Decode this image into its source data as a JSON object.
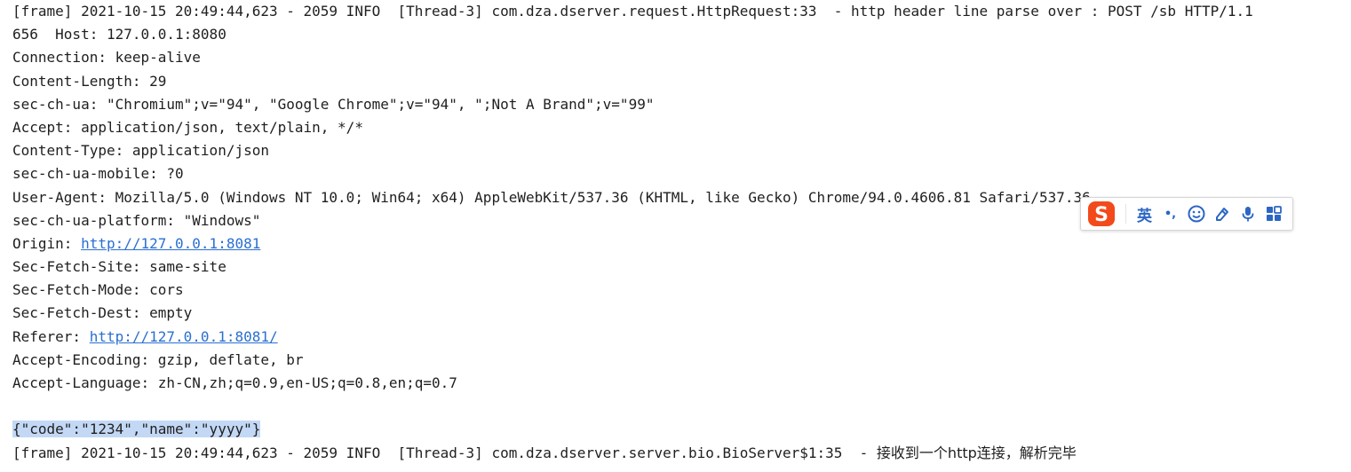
{
  "console": {
    "lines": [
      "[frame] 2021-10-15 20:49:44,623 - 2059 INFO  [Thread-3] com.dza.dserver.request.HttpRequest:33  - http header line parse over : POST /sb HTTP/1.1",
      "656  Host: 127.0.0.1:8080",
      "Connection: keep-alive",
      "Content-Length: 29",
      "sec-ch-ua: \"Chromium\";v=\"94\", \"Google Chrome\";v=\"94\", \";Not A Brand\";v=\"99\"",
      "Accept: application/json, text/plain, */*",
      "Content-Type: application/json",
      "sec-ch-ua-mobile: ?0",
      "User-Agent: Mozilla/5.0 (Windows NT 10.0; Win64; x64) AppleWebKit/537.36 (KHTML, like Gecko) Chrome/94.0.4606.81 Safari/537.36",
      "sec-ch-ua-platform: \"Windows\""
    ],
    "origin": {
      "prefix": "Origin: ",
      "url": "http://127.0.0.1:8081"
    },
    "lines_mid": [
      "Sec-Fetch-Site: same-site",
      "Sec-Fetch-Mode: cors",
      "Sec-Fetch-Dest: empty"
    ],
    "referer": {
      "prefix": "Referer: ",
      "url": "http://127.0.0.1:8081/"
    },
    "lines_end": [
      "Accept-Encoding: gzip, deflate, br",
      "Accept-Language: zh-CN,zh;q=0.9,en-US;q=0.8,en;q=0.7"
    ],
    "blank": "",
    "body_json": "{\"code\":\"1234\",\"name\":\"yyyy\"}",
    "last_prefix": "[frame] 2021-10-15 20:49:44,623 - 2059 INFO  [Thread-3] com.dza.dserver.server.bio.BioServer$1:35  - ",
    "last_cjk": "接收到一个http连接，解析完毕"
  },
  "ime": {
    "mode_label": "英",
    "punct_label": "•,",
    "icons": [
      "sogou-logo-icon",
      "emoji-icon",
      "pen-icon",
      "microphone-icon",
      "grid-icon"
    ],
    "colors": {
      "accent": "#2b66c4",
      "logo": "#f24a1a"
    }
  }
}
